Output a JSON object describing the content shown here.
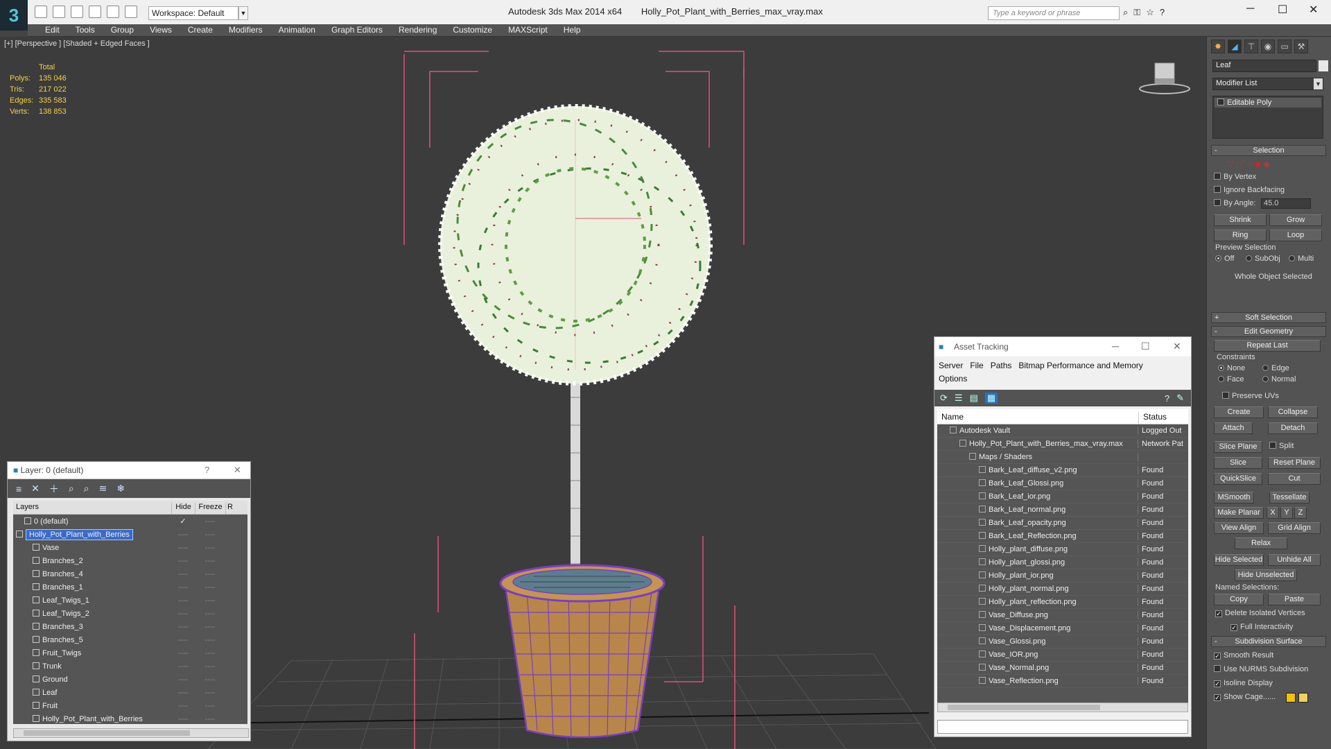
{
  "titlebar": {
    "workspace": "Workspace: Default",
    "app": "Autodesk 3ds Max  2014 x64",
    "file": "Holly_Pot_Plant_with_Berries_max_vray.max",
    "search_placeholder": "Type a keyword or phrase"
  },
  "menu": [
    "Edit",
    "Tools",
    "Group",
    "Views",
    "Create",
    "Modifiers",
    "Animation",
    "Graph Editors",
    "Rendering",
    "Customize",
    "MAXScript",
    "Help"
  ],
  "viewport": {
    "label": "[+] [Perspective ] [Shaded + Edged Faces ]",
    "stats": {
      "header": "Total",
      "rows": [
        {
          "k": "Polys:",
          "v": "135 046"
        },
        {
          "k": "Tris:",
          "v": "217 022"
        },
        {
          "k": "Edges:",
          "v": "335 583"
        },
        {
          "k": "Verts:",
          "v": "138 853"
        }
      ]
    }
  },
  "layer_panel": {
    "title": "Layer: 0 (default)",
    "help": "?",
    "close": "✕",
    "columns": {
      "name": "Layers",
      "hide": "Hide",
      "freeze": "Freeze",
      "r": "R"
    },
    "layers": [
      {
        "name": "0 (default)",
        "indent": 1,
        "check": "✓"
      },
      {
        "name": "Holly_Pot_Plant_with_Berries",
        "indent": 0,
        "selected": true
      },
      {
        "name": "Vase",
        "indent": 2
      },
      {
        "name": "Branches_2",
        "indent": 2
      },
      {
        "name": "Branches_4",
        "indent": 2
      },
      {
        "name": "Branches_1",
        "indent": 2
      },
      {
        "name": "Leaf_Twigs_1",
        "indent": 2
      },
      {
        "name": "Leaf_Twigs_2",
        "indent": 2
      },
      {
        "name": "Branches_3",
        "indent": 2
      },
      {
        "name": "Branches_5",
        "indent": 2
      },
      {
        "name": "Fruit_Twigs",
        "indent": 2
      },
      {
        "name": "Trunk",
        "indent": 2
      },
      {
        "name": "Ground",
        "indent": 2
      },
      {
        "name": "Leaf",
        "indent": 2
      },
      {
        "name": "Fruit",
        "indent": 2
      },
      {
        "name": "Holly_Pot_Plant_with_Berries",
        "indent": 2
      }
    ],
    "dash": "----"
  },
  "asset_panel": {
    "title": "Asset Tracking",
    "menu_line1": [
      "Server",
      "File",
      "Paths",
      "Bitmap Performance and Memory"
    ],
    "menu_line2": [
      "Options"
    ],
    "columns": {
      "name": "Name",
      "status": "Status"
    },
    "rows": [
      {
        "name": "Autodesk Vault",
        "status": "Logged Out",
        "indent": 1
      },
      {
        "name": "Holly_Pot_Plant_with_Berries_max_vray.max",
        "status": "Network Pat",
        "indent": 2
      },
      {
        "name": "Maps / Shaders",
        "status": "",
        "indent": 3
      },
      {
        "name": "Bark_Leaf_diffuse_v2.png",
        "status": "Found",
        "indent": 4
      },
      {
        "name": "Bark_Leaf_Glossi.png",
        "status": "Found",
        "indent": 4
      },
      {
        "name": "Bark_Leaf_ior.png",
        "status": "Found",
        "indent": 4
      },
      {
        "name": "Bark_Leaf_normal.png",
        "status": "Found",
        "indent": 4
      },
      {
        "name": "Bark_Leaf_opacity.png",
        "status": "Found",
        "indent": 4
      },
      {
        "name": "Bark_Leaf_Reflection.png",
        "status": "Found",
        "indent": 4
      },
      {
        "name": "Holly_plant_diffuse.png",
        "status": "Found",
        "indent": 4
      },
      {
        "name": "Holly_plant_glossi.png",
        "status": "Found",
        "indent": 4
      },
      {
        "name": "Holly_plant_ior.png",
        "status": "Found",
        "indent": 4
      },
      {
        "name": "Holly_plant_normal.png",
        "status": "Found",
        "indent": 4
      },
      {
        "name": "Holly_plant_reflection.png",
        "status": "Found",
        "indent": 4
      },
      {
        "name": "Vase_Diffuse.png",
        "status": "Found",
        "indent": 4
      },
      {
        "name": "Vase_Displacement.png",
        "status": "Found",
        "indent": 4
      },
      {
        "name": "Vase_Glossi.png",
        "status": "Found",
        "indent": 4
      },
      {
        "name": "Vase_IOR.png",
        "status": "Found",
        "indent": 4
      },
      {
        "name": "Vase_Normal.png",
        "status": "Found",
        "indent": 4
      },
      {
        "name": "Vase_Reflection.png",
        "status": "Found",
        "indent": 4
      }
    ]
  },
  "command_panel": {
    "object_name": "Leaf",
    "modifier_list": "Modifier List",
    "stack_item": "Editable Poly",
    "selection": {
      "title": "Selection",
      "by_vertex": "By Vertex",
      "ignore_backfacing": "Ignore Backfacing",
      "by_angle": "By Angle:",
      "angle_value": "45.0",
      "shrink": "Shrink",
      "grow": "Grow",
      "ring": "Ring",
      "loop": "Loop",
      "preview_selection": "Preview Selection",
      "off": "Off",
      "subobj": "SubObj",
      "multi": "Multi",
      "whole_object": "Whole Object Selected"
    },
    "soft_selection": "Soft Selection",
    "edit_geometry": {
      "title": "Edit Geometry",
      "repeat_last": "Repeat Last",
      "constraints": "Constraints",
      "none": "None",
      "edge": "Edge",
      "face": "Face",
      "normal": "Normal",
      "preserve_uvs": "Preserve UVs",
      "create": "Create",
      "collapse": "Collapse",
      "attach": "Attach",
      "detach": "Detach",
      "slice_plane": "Slice Plane",
      "split": "Split",
      "slice": "Slice",
      "reset_plane": "Reset Plane",
      "quickslice": "QuickSlice",
      "cut": "Cut",
      "msmooth": "MSmooth",
      "tessellate": "Tessellate",
      "make_planar": "Make Planar",
      "x": "X",
      "y": "Y",
      "z": "Z",
      "view_align": "View Align",
      "grid_align": "Grid Align",
      "relax": "Relax",
      "hide_selected": "Hide Selected",
      "unhide_all": "Unhide All",
      "hide_unselected": "Hide Unselected",
      "named_selections": "Named Selections:",
      "copy": "Copy",
      "paste": "Paste",
      "delete_isolated": "Delete Isolated Vertices",
      "full_interactivity": "Full Interactivity"
    },
    "subdivision": {
      "title": "Subdivision Surface",
      "smooth_result": "Smooth Result",
      "use_nurms": "Use NURMS Subdivision",
      "isoline": "Isoline Display",
      "show_cage": "Show Cage......"
    },
    "colors": {
      "cage1": "#f5c000",
      "cage2": "#f0d060",
      "selection_red": "#e02020"
    }
  },
  "colors": {
    "viewport_bg": "#3c3c3c",
    "stat_text": "#f4d24a",
    "bbox": "#e0507a",
    "vase_wire": "#7a3fc0",
    "vase_fill": "#b8864a"
  }
}
